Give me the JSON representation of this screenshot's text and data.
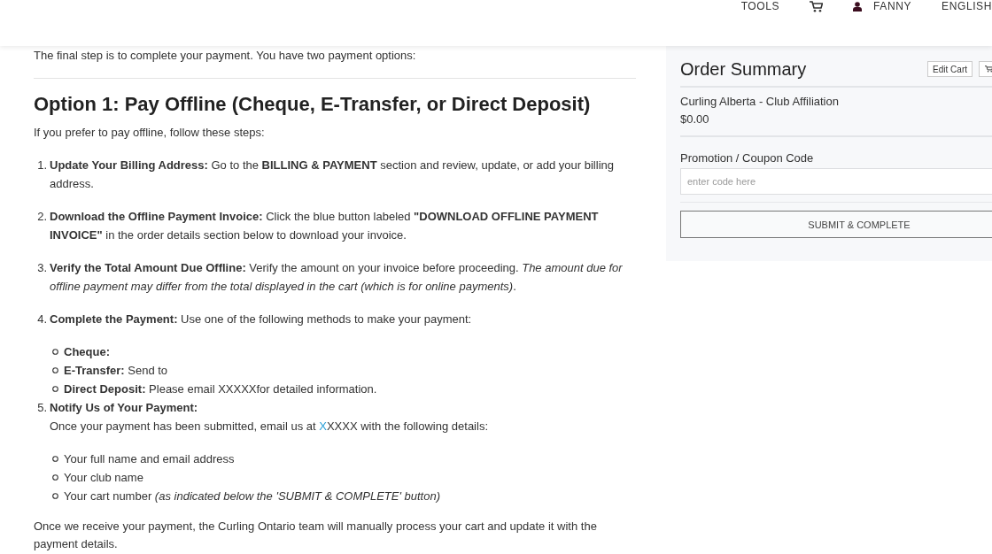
{
  "header": {
    "tools_label": "TOOLS",
    "user_name": "FANNY",
    "language": "ENGLISH"
  },
  "content": {
    "intro": "The final step is to complete your payment. You have two payment options:",
    "heading": "Option 1: Pay Offline (Cheque, E-Transfer, or Direct Deposit)",
    "lead": "If you prefer to pay offline, follow these steps:",
    "steps": [
      {
        "number": "1.",
        "text": "**Update Your Billing Address:** Go to the **BILLING & PAYMENT** section and review, update, or add your billing address."
      },
      {
        "number": "2.",
        "text": "**Download the Offline Payment Invoice:** Click the blue button labeled **\"DOWNLOAD OFFLINE PAYMENT INVOICE\"** in the order details section below to download your invoice."
      },
      {
        "number": "3.",
        "text": "**Verify the Total Amount Due Offline:** Verify the amount on your invoice before proceeding. *The amount due for offline payment may differ from the total displayed in the cart (which is for online payments)*."
      },
      {
        "number": "4.",
        "text": "**Complete the Payment:** Use one of the following methods to make your payment:",
        "bullets": [
          {
            "label": "Cheque:"
          },
          {
            "label": "E-Transfer:",
            "text": "Send to"
          },
          {
            "label": "Direct Deposit:",
            "text": "Please email XXXXXfor detailed information."
          }
        ]
      },
      {
        "number": "5.",
        "title": "Notify Us of Your Payment:",
        "note": {
          "before": "Once your payment has been submitted, email us at",
          "link": "X",
          "after": "XXXX with the following details:"
        },
        "bullets": [
          {
            "text": "Your full name and email address"
          },
          {
            "text": "Your club name"
          },
          {
            "text": "Your cart number *(as indicated below the 'SUBMIT & COMPLETE' button)*"
          }
        ]
      }
    ],
    "closing": "Once we receive your payment, the Curling Ontario team will manually process your cart and update it with the payment details."
  },
  "order_summary": {
    "title": "Order Summary",
    "edit_button": "Edit Cart",
    "items": [
      {
        "name": "Curling Alberta - Club Affiliation",
        "price": "$0.00"
      }
    ],
    "coupon": {
      "label": "Promotion / Coupon Code",
      "placeholder": "enter code here"
    },
    "submit_button": "SUBMIT & COMPLETE"
  }
}
